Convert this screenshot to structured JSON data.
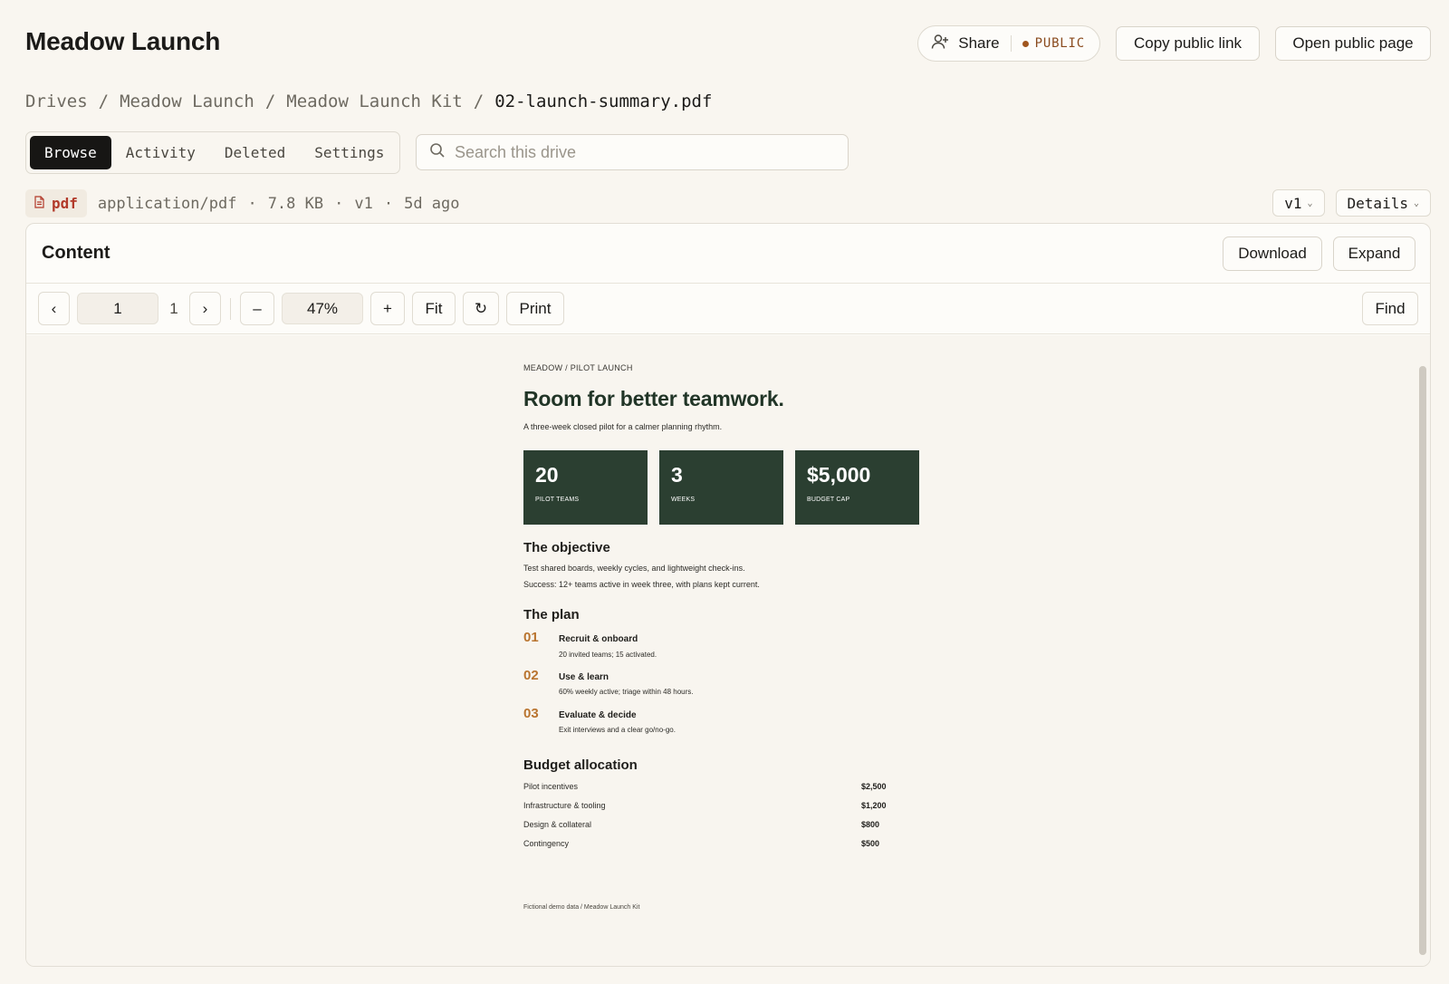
{
  "app": {
    "title": "Meadow Launch"
  },
  "header": {
    "share_label": "Share",
    "public_badge": "PUBLIC",
    "copy_link_label": "Copy public link",
    "open_page_label": "Open public page"
  },
  "breadcrumb": [
    "Drives",
    "Meadow Launch",
    "Meadow Launch Kit",
    "02-launch-summary.pdf"
  ],
  "tabs": [
    "Browse",
    "Activity",
    "Deleted",
    "Settings"
  ],
  "search": {
    "placeholder": "Search this drive"
  },
  "file_meta": {
    "type": "pdf",
    "mime": "application/pdf",
    "size": "7.8 KB",
    "version": "v1",
    "age": "5d ago",
    "separator": "·",
    "version_select": "v1",
    "details_label": "Details"
  },
  "panel": {
    "title": "Content",
    "download_label": "Download",
    "expand_label": "Expand"
  },
  "toolbar": {
    "prev": "‹",
    "page_value": "1",
    "page_total": "1",
    "next": "›",
    "zoom_out": "–",
    "zoom_value": "47%",
    "zoom_in": "+",
    "fit_label": "Fit",
    "rotate": "↻",
    "print_label": "Print",
    "find_label": "Find"
  },
  "document": {
    "kicker": "MEADOW  /  PILOT LAUNCH",
    "title": "Room for better teamwork.",
    "subtitle": "A three-week closed pilot for a calmer planning rhythm.",
    "stats": [
      {
        "value": "20",
        "label": "PILOT TEAMS"
      },
      {
        "value": "3",
        "label": "WEEKS"
      },
      {
        "value": "$5,000",
        "label": "BUDGET CAP"
      }
    ],
    "objective": {
      "heading": "The objective",
      "lines": [
        "Test shared boards, weekly cycles, and lightweight check-ins.",
        "Success: 12+ teams active in week three, with plans kept current."
      ]
    },
    "plan": {
      "heading": "The plan",
      "steps": [
        {
          "num": "01",
          "title": "Recruit & onboard",
          "desc": "20 invited teams; 15 activated."
        },
        {
          "num": "02",
          "title": "Use & learn",
          "desc": "60% weekly active; triage within 48 hours."
        },
        {
          "num": "03",
          "title": "Evaluate & decide",
          "desc": "Exit interviews and a clear go/no-go."
        }
      ]
    },
    "budget": {
      "heading": "Budget allocation",
      "rows": [
        {
          "label": "Pilot incentives",
          "amount": "$2,500"
        },
        {
          "label": "Infrastructure & tooling",
          "amount": "$1,200"
        },
        {
          "label": "Design & collateral",
          "amount": "$800"
        },
        {
          "label": "Contingency",
          "amount": "$500"
        }
      ]
    },
    "footer": "Fictional demo data  /  Meadow Launch Kit"
  }
}
